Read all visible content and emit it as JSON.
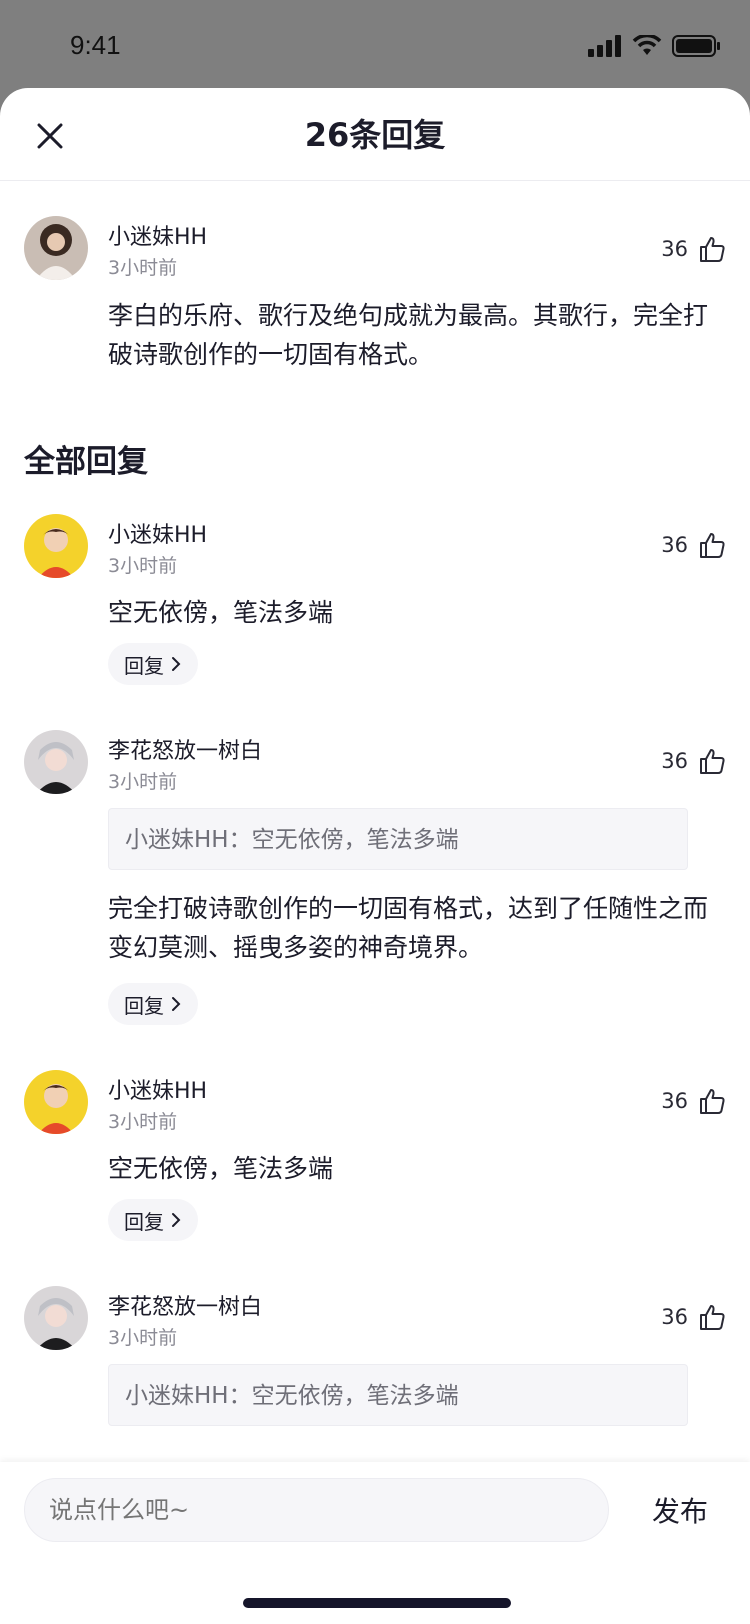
{
  "status_bar": {
    "time": "9:41"
  },
  "header": {
    "title": "26条回复"
  },
  "main_comment": {
    "author": "小迷妹HH",
    "time": "3小时前",
    "likes": "36",
    "text": "李白的乐府、歌行及绝句成就为最高。其歌行，完全打破诗歌创作的一切固有格式。"
  },
  "section_title": "全部回复",
  "replies": [
    {
      "author": "小迷妹HH",
      "time": "3小时前",
      "likes": "36",
      "text": "空无依傍，笔法多端",
      "reply_label": "回复"
    },
    {
      "author": "李花怒放一树白",
      "time": "3小时前",
      "likes": "36",
      "quote": "小迷妹HH：空无依傍，笔法多端",
      "text": "完全打破诗歌创作的一切固有格式，达到了任随性之而变幻莫测、摇曳多姿的神奇境界。",
      "reply_label": "回复"
    },
    {
      "author": "小迷妹HH",
      "time": "3小时前",
      "likes": "36",
      "text": "空无依傍，笔法多端",
      "reply_label": "回复"
    },
    {
      "author": "李花怒放一树白",
      "time": "3小时前",
      "likes": "36",
      "quote": "小迷妹HH：空无依傍，笔法多端"
    }
  ],
  "bottom_bar": {
    "input_placeholder": "说点什么吧~",
    "publish_label": "发布"
  },
  "colors": {
    "background_overlay": "#7f7f7f",
    "text": "#1c1c2a",
    "muted": "#8b8b95",
    "quote_bg": "#f6f6f9"
  }
}
